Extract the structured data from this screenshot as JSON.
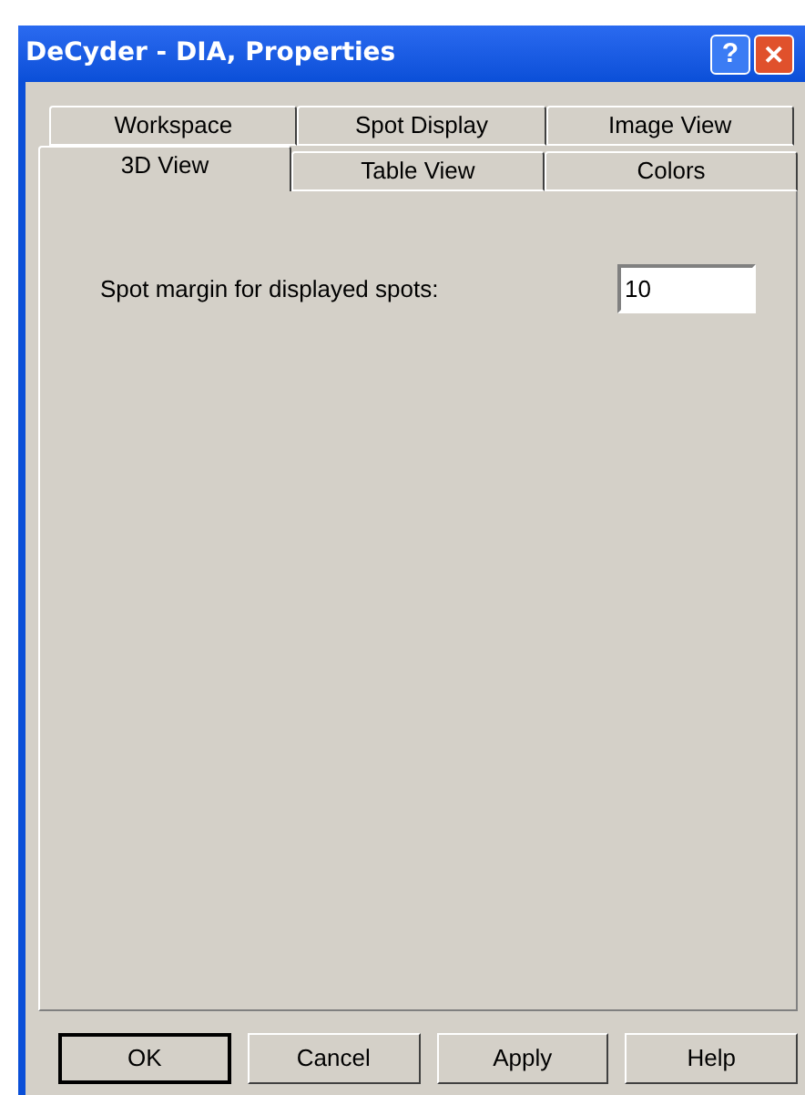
{
  "window": {
    "title": "DeCyder - DIA, Properties"
  },
  "title_buttons": [
    {
      "kind": "help",
      "label": "?"
    },
    {
      "kind": "close",
      "label": "✕"
    }
  ],
  "tab_rows": [
    {
      "tabs": [
        {
          "label": "Workspace",
          "selected": false
        },
        {
          "label": "Spot Display",
          "selected": false
        },
        {
          "label": "Image View",
          "selected": false
        }
      ]
    },
    {
      "tabs": [
        {
          "label": "3D View",
          "selected": true
        },
        {
          "label": "Table View",
          "selected": false
        },
        {
          "label": "Colors",
          "selected": false
        }
      ]
    }
  ],
  "fields": [
    {
      "label": "Spot margin for displayed spots:",
      "value": "10"
    }
  ],
  "buttons": [
    {
      "label": "OK",
      "default": true
    },
    {
      "label": "Cancel",
      "default": false
    },
    {
      "label": "Apply",
      "default": false
    },
    {
      "label": "Help",
      "default": false
    }
  ]
}
